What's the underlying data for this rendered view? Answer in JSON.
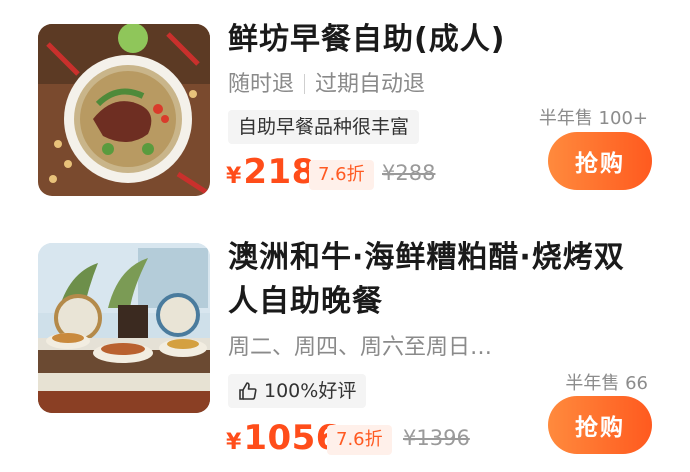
{
  "products": [
    {
      "title": "鲜坊早餐自助(成人)",
      "desc_parts": [
        "随时退",
        "过期自动退"
      ],
      "tag": "自助早餐品种很丰富",
      "tag_icon": "none",
      "currency": "¥",
      "price": "218",
      "discount": "7.6折",
      "original_price": "¥288",
      "sold": "半年售 100+",
      "buy_label": "抢购",
      "image": "beef-noodle-soup-bowl"
    },
    {
      "title": "澳洲和牛·海鲜糟粕醋·烧烤双人自助晚餐",
      "desc_parts": [
        "周二、周四、周六至周日…"
      ],
      "tag": "100%好评",
      "tag_icon": "thumbs-up-icon",
      "currency": "¥",
      "price": "1056",
      "discount": "7.6折",
      "original_price": "¥1396",
      "sold": "半年售 66",
      "buy_label": "抢购",
      "image": "buffet-counter-dishes"
    }
  ],
  "colors": {
    "price": "#ff4d1a",
    "button_start": "#ff8a3d",
    "button_end": "#ff5a1f",
    "discount_bg": "#fff0ea"
  }
}
